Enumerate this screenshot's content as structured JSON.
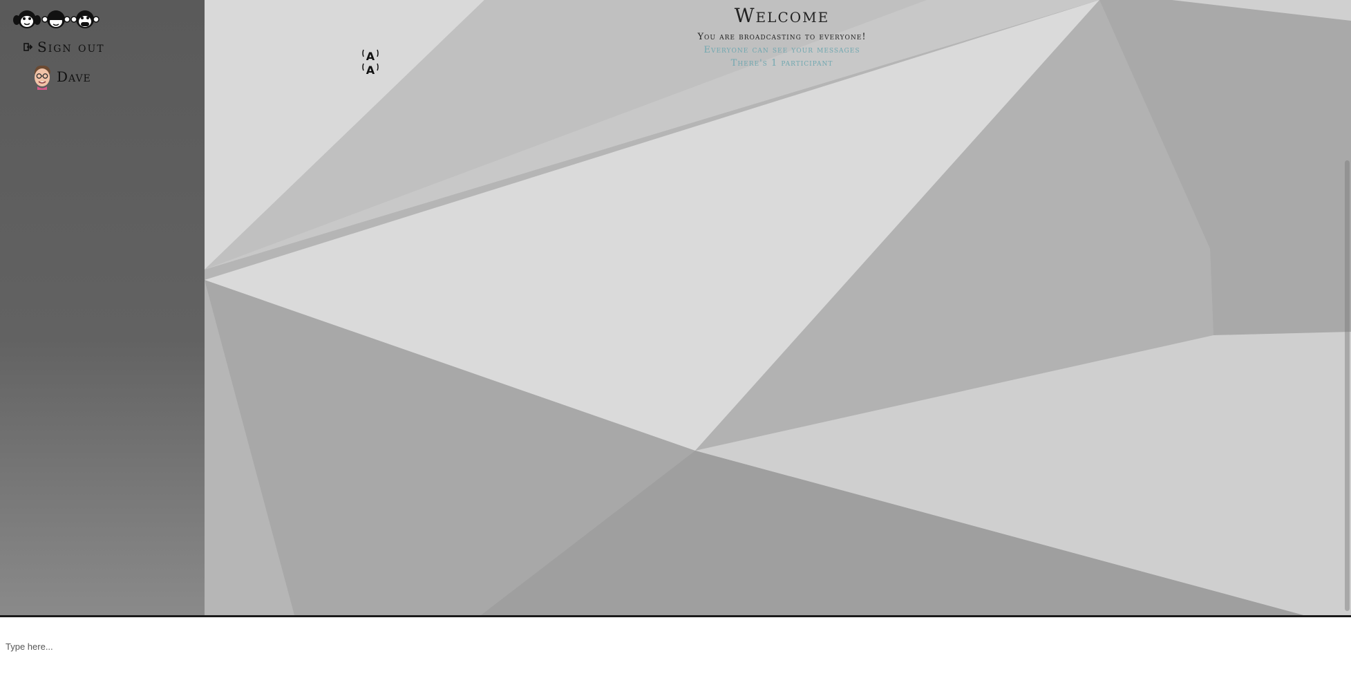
{
  "sidebar": {
    "logo_icons": [
      "hear-no-evil-monkey-icon",
      "see-no-evil-monkey-icon",
      "speak-no-evil-monkey-icon"
    ],
    "sign_out_label": "Sign out",
    "user": {
      "name": "Dave",
      "avatar_icon": "avatar"
    }
  },
  "header": {
    "title": "Welcome",
    "broadcast_text": "You are broadcasting to everyone!",
    "visibility_text": "Everyone can see your messages",
    "participants_text": "There's 1 participant"
  },
  "composer": {
    "placeholder": "Type here..."
  },
  "colors": {
    "accent": "#6fa7b0",
    "sidebar": "#5e5e5e",
    "divider": "#1a1a1a"
  }
}
